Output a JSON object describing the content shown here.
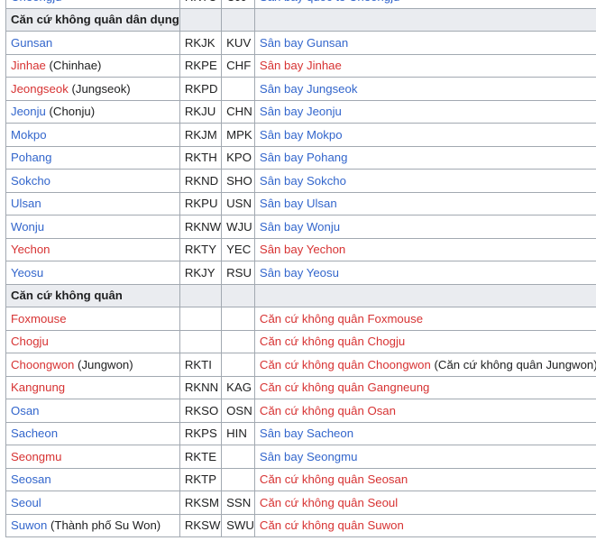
{
  "colors": {
    "link": "#3366cc",
    "redlink": "#d73333",
    "text": "#202122",
    "header_bg": "#eaecf0",
    "border": "#a2a9b1"
  },
  "top_partial": {
    "city": [
      {
        "t": "Cheongju",
        "c": "blue"
      }
    ],
    "icao": "RKTU",
    "iata": "CJJ",
    "airport": [
      {
        "t": "Sân bay quốc tế Cheongju",
        "c": "blue"
      }
    ]
  },
  "sections": [
    {
      "title": "Căn cứ không quân dân dụng",
      "rows": [
        {
          "city": [
            {
              "t": "Gunsan",
              "c": "blue"
            }
          ],
          "icao": "RKJK",
          "iata": "KUV",
          "airport": [
            {
              "t": "Sân bay Gunsan",
              "c": "blue"
            }
          ]
        },
        {
          "city": [
            {
              "t": "Jinhae",
              "c": "red"
            },
            {
              "t": " (Chinhae)",
              "c": "plain"
            }
          ],
          "icao": "RKPE",
          "iata": "CHF",
          "airport": [
            {
              "t": "Sân bay Jinhae",
              "c": "red"
            }
          ]
        },
        {
          "city": [
            {
              "t": "Jeongseok",
              "c": "red"
            },
            {
              "t": " (Jungseok)",
              "c": "plain"
            }
          ],
          "icao": "RKPD",
          "iata": "",
          "airport": [
            {
              "t": "Sân bay Jungseok",
              "c": "blue"
            }
          ]
        },
        {
          "city": [
            {
              "t": "Jeonju",
              "c": "blue"
            },
            {
              "t": " (Chonju)",
              "c": "plain"
            }
          ],
          "icao": "RKJU",
          "iata": "CHN",
          "airport": [
            {
              "t": "Sân bay Jeonju",
              "c": "blue"
            }
          ]
        },
        {
          "city": [
            {
              "t": "Mokpo",
              "c": "blue"
            }
          ],
          "icao": "RKJM",
          "iata": "MPK",
          "airport": [
            {
              "t": "Sân bay Mokpo",
              "c": "blue"
            }
          ]
        },
        {
          "city": [
            {
              "t": "Pohang",
              "c": "blue"
            }
          ],
          "icao": "RKTH",
          "iata": "KPO",
          "airport": [
            {
              "t": "Sân bay Pohang",
              "c": "blue"
            }
          ]
        },
        {
          "city": [
            {
              "t": "Sokcho",
              "c": "blue"
            }
          ],
          "icao": "RKND",
          "iata": "SHO",
          "airport": [
            {
              "t": "Sân bay Sokcho",
              "c": "blue"
            }
          ]
        },
        {
          "city": [
            {
              "t": "Ulsan",
              "c": "blue"
            }
          ],
          "icao": "RKPU",
          "iata": "USN",
          "airport": [
            {
              "t": "Sân bay Ulsan",
              "c": "blue"
            }
          ]
        },
        {
          "city": [
            {
              "t": "Wonju",
              "c": "blue"
            }
          ],
          "icao": "RKNW",
          "iata": "WJU",
          "airport": [
            {
              "t": "Sân bay Wonju",
              "c": "blue"
            }
          ]
        },
        {
          "city": [
            {
              "t": "Yechon",
              "c": "red"
            }
          ],
          "icao": "RKTY",
          "iata": "YEC",
          "airport": [
            {
              "t": "Sân bay Yechon",
              "c": "red"
            }
          ]
        },
        {
          "city": [
            {
              "t": "Yeosu",
              "c": "blue"
            }
          ],
          "icao": "RKJY",
          "iata": "RSU",
          "airport": [
            {
              "t": "Sân bay Yeosu",
              "c": "blue"
            }
          ]
        }
      ]
    },
    {
      "title": "Căn cứ không quân",
      "rows": [
        {
          "city": [
            {
              "t": "Foxmouse",
              "c": "red"
            }
          ],
          "icao": "",
          "iata": "",
          "airport": [
            {
              "t": "Căn cứ không quân Foxmouse",
              "c": "red"
            }
          ]
        },
        {
          "city": [
            {
              "t": "Chogju",
              "c": "red"
            }
          ],
          "icao": "",
          "iata": "",
          "airport": [
            {
              "t": "Căn cứ không quân Chogju",
              "c": "red"
            }
          ]
        },
        {
          "city": [
            {
              "t": "Choongwon",
              "c": "red"
            },
            {
              "t": " (Jungwon)",
              "c": "plain"
            }
          ],
          "icao": "RKTI",
          "iata": "",
          "airport": [
            {
              "t": "Căn cứ không quân Choongwon",
              "c": "red"
            },
            {
              "t": " (Căn cứ không quân Jungwon)",
              "c": "plain"
            }
          ]
        },
        {
          "city": [
            {
              "t": "Kangnung",
              "c": "red"
            }
          ],
          "icao": "RKNN",
          "iata": "KAG",
          "airport": [
            {
              "t": "Căn cứ không quân Gangneung",
              "c": "red"
            }
          ]
        },
        {
          "city": [
            {
              "t": "Osan",
              "c": "blue"
            }
          ],
          "icao": "RKSO",
          "iata": "OSN",
          "airport": [
            {
              "t": "Căn cứ không quân Osan",
              "c": "red"
            }
          ]
        },
        {
          "city": [
            {
              "t": "Sacheon",
              "c": "blue"
            }
          ],
          "icao": "RKPS",
          "iata": "HIN",
          "airport": [
            {
              "t": "Sân bay Sacheon",
              "c": "blue"
            }
          ]
        },
        {
          "city": [
            {
              "t": "Seongmu",
              "c": "red"
            }
          ],
          "icao": "RKTE",
          "iata": "",
          "airport": [
            {
              "t": "Sân bay Seongmu",
              "c": "blue"
            }
          ]
        },
        {
          "city": [
            {
              "t": "Seosan",
              "c": "blue"
            }
          ],
          "icao": "RKTP",
          "iata": "",
          "airport": [
            {
              "t": "Căn cứ không quân Seosan",
              "c": "red"
            }
          ]
        },
        {
          "city": [
            {
              "t": "Seoul",
              "c": "blue"
            }
          ],
          "icao": "RKSM",
          "iata": "SSN",
          "airport": [
            {
              "t": "Căn cứ không quân Seoul",
              "c": "red"
            }
          ]
        },
        {
          "city": [
            {
              "t": "Suwon",
              "c": "blue"
            },
            {
              "t": " (Thành phố Su Won)",
              "c": "plain"
            }
          ],
          "icao": "RKSW",
          "iata": "SWU",
          "airport": [
            {
              "t": "Căn cứ không quân Suwon",
              "c": "red"
            }
          ]
        }
      ]
    }
  ]
}
